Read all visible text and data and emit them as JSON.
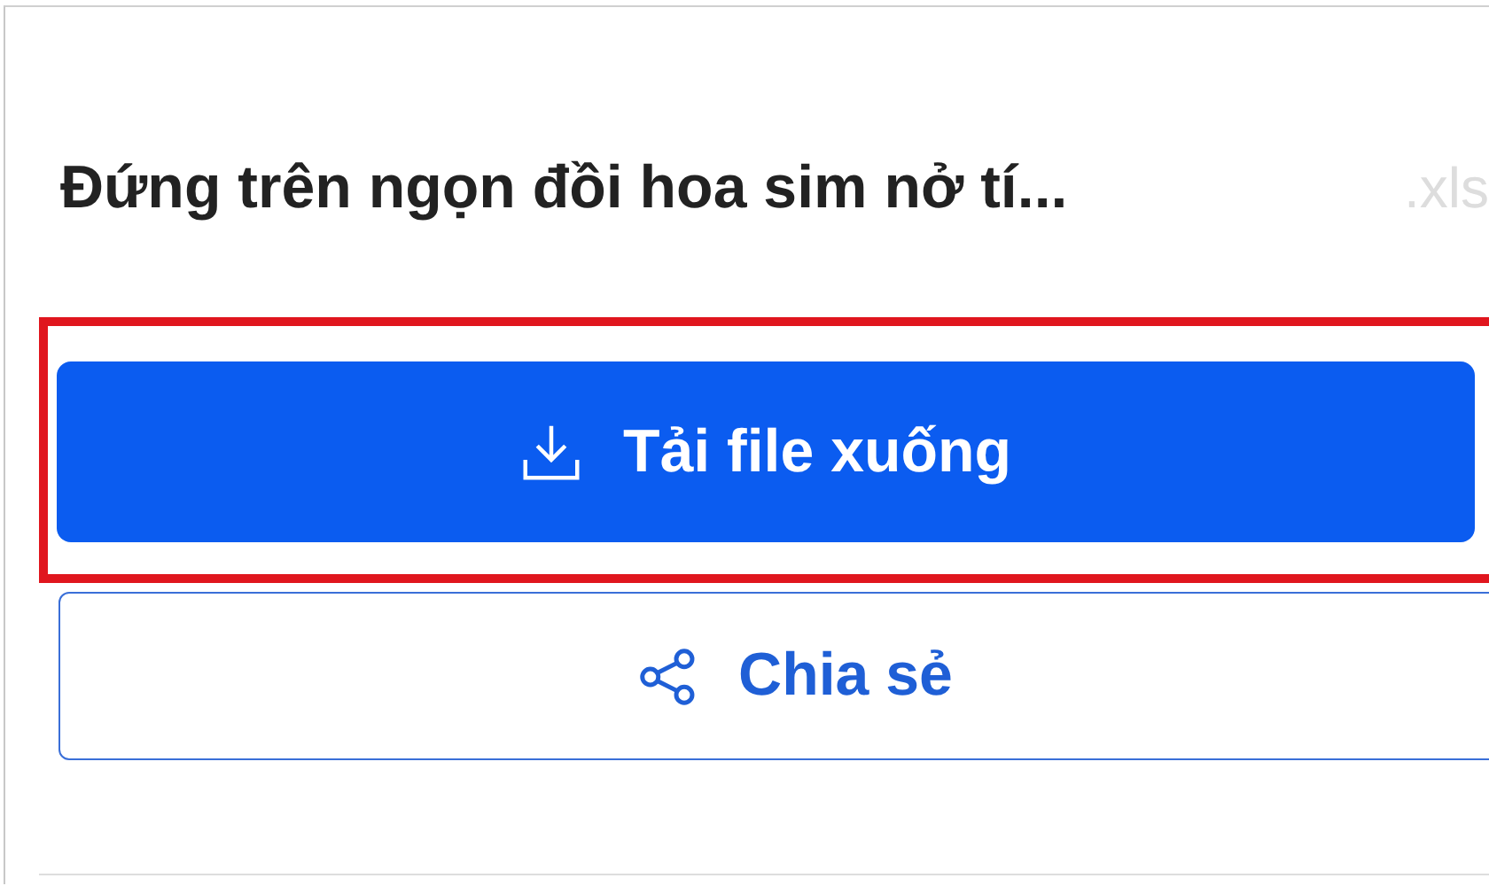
{
  "file": {
    "title": "Đứng trên ngọn đồi hoa sim nở tí...",
    "extension": ".xls"
  },
  "actions": [
    {
      "kind": "primary",
      "label": "Tải file xuống",
      "highlighted": true
    },
    {
      "kind": "secondary",
      "label": "Chia sẻ",
      "highlighted": false
    }
  ]
}
